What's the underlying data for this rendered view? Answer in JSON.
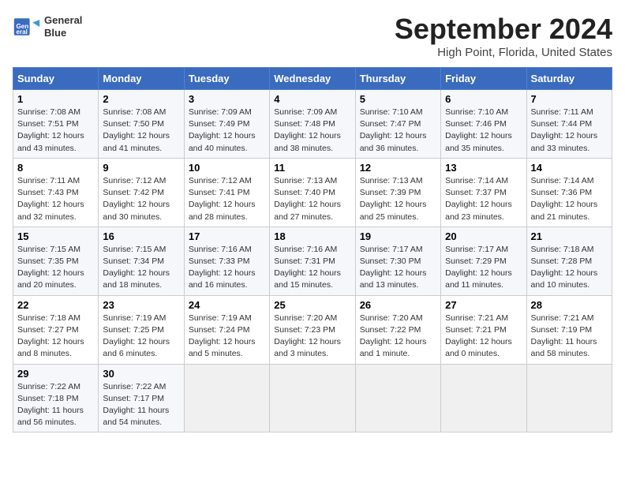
{
  "header": {
    "logo_line1": "General",
    "logo_line2": "Blue",
    "month": "September 2024",
    "location": "High Point, Florida, United States"
  },
  "weekdays": [
    "Sunday",
    "Monday",
    "Tuesday",
    "Wednesday",
    "Thursday",
    "Friday",
    "Saturday"
  ],
  "weeks": [
    [
      {
        "day": "1",
        "info": "Sunrise: 7:08 AM\nSunset: 7:51 PM\nDaylight: 12 hours\nand 43 minutes."
      },
      {
        "day": "2",
        "info": "Sunrise: 7:08 AM\nSunset: 7:50 PM\nDaylight: 12 hours\nand 41 minutes."
      },
      {
        "day": "3",
        "info": "Sunrise: 7:09 AM\nSunset: 7:49 PM\nDaylight: 12 hours\nand 40 minutes."
      },
      {
        "day": "4",
        "info": "Sunrise: 7:09 AM\nSunset: 7:48 PM\nDaylight: 12 hours\nand 38 minutes."
      },
      {
        "day": "5",
        "info": "Sunrise: 7:10 AM\nSunset: 7:47 PM\nDaylight: 12 hours\nand 36 minutes."
      },
      {
        "day": "6",
        "info": "Sunrise: 7:10 AM\nSunset: 7:46 PM\nDaylight: 12 hours\nand 35 minutes."
      },
      {
        "day": "7",
        "info": "Sunrise: 7:11 AM\nSunset: 7:44 PM\nDaylight: 12 hours\nand 33 minutes."
      }
    ],
    [
      {
        "day": "8",
        "info": "Sunrise: 7:11 AM\nSunset: 7:43 PM\nDaylight: 12 hours\nand 32 minutes."
      },
      {
        "day": "9",
        "info": "Sunrise: 7:12 AM\nSunset: 7:42 PM\nDaylight: 12 hours\nand 30 minutes."
      },
      {
        "day": "10",
        "info": "Sunrise: 7:12 AM\nSunset: 7:41 PM\nDaylight: 12 hours\nand 28 minutes."
      },
      {
        "day": "11",
        "info": "Sunrise: 7:13 AM\nSunset: 7:40 PM\nDaylight: 12 hours\nand 27 minutes."
      },
      {
        "day": "12",
        "info": "Sunrise: 7:13 AM\nSunset: 7:39 PM\nDaylight: 12 hours\nand 25 minutes."
      },
      {
        "day": "13",
        "info": "Sunrise: 7:14 AM\nSunset: 7:37 PM\nDaylight: 12 hours\nand 23 minutes."
      },
      {
        "day": "14",
        "info": "Sunrise: 7:14 AM\nSunset: 7:36 PM\nDaylight: 12 hours\nand 21 minutes."
      }
    ],
    [
      {
        "day": "15",
        "info": "Sunrise: 7:15 AM\nSunset: 7:35 PM\nDaylight: 12 hours\nand 20 minutes."
      },
      {
        "day": "16",
        "info": "Sunrise: 7:15 AM\nSunset: 7:34 PM\nDaylight: 12 hours\nand 18 minutes."
      },
      {
        "day": "17",
        "info": "Sunrise: 7:16 AM\nSunset: 7:33 PM\nDaylight: 12 hours\nand 16 minutes."
      },
      {
        "day": "18",
        "info": "Sunrise: 7:16 AM\nSunset: 7:31 PM\nDaylight: 12 hours\nand 15 minutes."
      },
      {
        "day": "19",
        "info": "Sunrise: 7:17 AM\nSunset: 7:30 PM\nDaylight: 12 hours\nand 13 minutes."
      },
      {
        "day": "20",
        "info": "Sunrise: 7:17 AM\nSunset: 7:29 PM\nDaylight: 12 hours\nand 11 minutes."
      },
      {
        "day": "21",
        "info": "Sunrise: 7:18 AM\nSunset: 7:28 PM\nDaylight: 12 hours\nand 10 minutes."
      }
    ],
    [
      {
        "day": "22",
        "info": "Sunrise: 7:18 AM\nSunset: 7:27 PM\nDaylight: 12 hours\nand 8 minutes."
      },
      {
        "day": "23",
        "info": "Sunrise: 7:19 AM\nSunset: 7:25 PM\nDaylight: 12 hours\nand 6 minutes."
      },
      {
        "day": "24",
        "info": "Sunrise: 7:19 AM\nSunset: 7:24 PM\nDaylight: 12 hours\nand 5 minutes."
      },
      {
        "day": "25",
        "info": "Sunrise: 7:20 AM\nSunset: 7:23 PM\nDaylight: 12 hours\nand 3 minutes."
      },
      {
        "day": "26",
        "info": "Sunrise: 7:20 AM\nSunset: 7:22 PM\nDaylight: 12 hours\nand 1 minute."
      },
      {
        "day": "27",
        "info": "Sunrise: 7:21 AM\nSunset: 7:21 PM\nDaylight: 12 hours\nand 0 minutes."
      },
      {
        "day": "28",
        "info": "Sunrise: 7:21 AM\nSunset: 7:19 PM\nDaylight: 11 hours\nand 58 minutes."
      }
    ],
    [
      {
        "day": "29",
        "info": "Sunrise: 7:22 AM\nSunset: 7:18 PM\nDaylight: 11 hours\nand 56 minutes."
      },
      {
        "day": "30",
        "info": "Sunrise: 7:22 AM\nSunset: 7:17 PM\nDaylight: 11 hours\nand 54 minutes."
      },
      {
        "day": "",
        "info": ""
      },
      {
        "day": "",
        "info": ""
      },
      {
        "day": "",
        "info": ""
      },
      {
        "day": "",
        "info": ""
      },
      {
        "day": "",
        "info": ""
      }
    ]
  ]
}
